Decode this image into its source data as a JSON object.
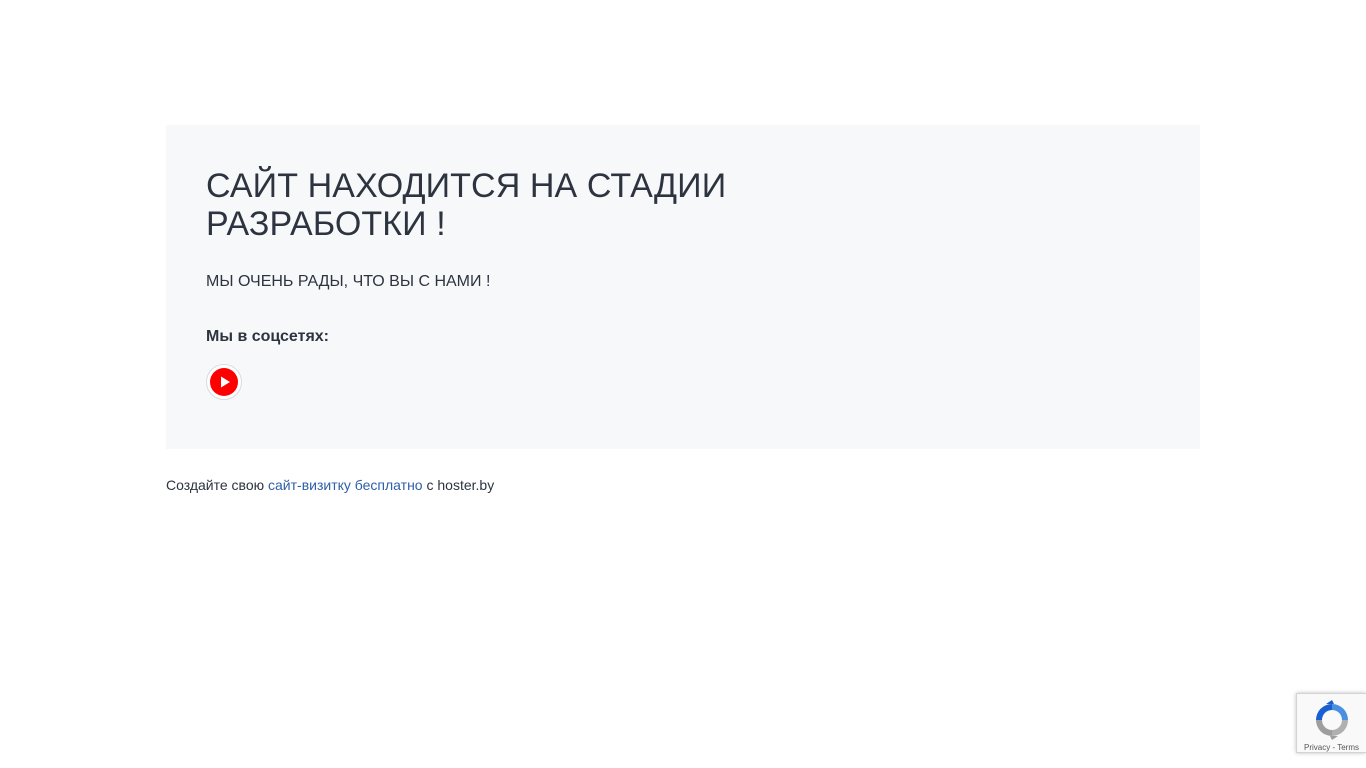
{
  "card": {
    "title": "САЙТ НАХОДИТСЯ НА СТАДИИ РАЗРАБОТКИ !",
    "subtitle": "МЫ ОЧЕНЬ РАДЫ, ЧТО ВЫ С НАМИ !",
    "social_heading": "Мы в соцсетях:",
    "social_links": [
      {
        "icon": "youtube-icon",
        "color": "#ff0000"
      }
    ]
  },
  "footer": {
    "prefix": "Создайте свою",
    "link_text": "сайт-визитку бесплатно",
    "suffix": "с hoster.by"
  },
  "recaptcha": {
    "privacy_label": "Privacy",
    "separator": " - ",
    "terms_label": "Terms"
  },
  "colors": {
    "card_background": "#f7f8fa",
    "text": "#2d3440",
    "link": "#2e5fa8",
    "youtube_red": "#ff0000"
  }
}
